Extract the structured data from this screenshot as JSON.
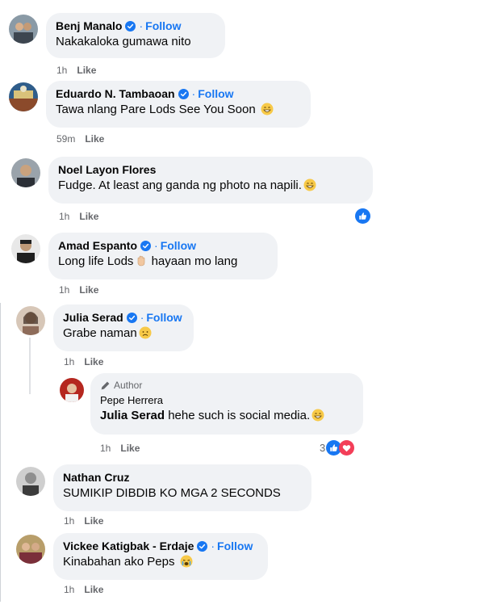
{
  "comments": [
    {
      "name": "Benj Manalo",
      "verified": true,
      "follow": "Follow",
      "text": "Nakakaloka gumawa nito",
      "time": "1h",
      "like": "Like"
    },
    {
      "name": "Eduardo N. Tambaoan",
      "verified": true,
      "follow": "Follow",
      "text": "Tawa nlang Pare Lods See You Soon",
      "time": "59m",
      "like": "Like"
    },
    {
      "name": "Noel Layon Flores",
      "verified": false,
      "text": "Fudge. At least ang ganda ng photo na napili.",
      "time": "1h",
      "like": "Like"
    },
    {
      "name": "Amad Espanto",
      "verified": true,
      "follow": "Follow",
      "text_before": "Long life Lods",
      "text_after": " hayaan mo lang",
      "time": "1h",
      "like": "Like"
    },
    {
      "name": "Julia Serad",
      "verified": true,
      "follow": "Follow",
      "text": "Grabe naman",
      "time": "1h",
      "like": "Like"
    },
    {
      "author_tag": "Author",
      "name": "Pepe Herrera",
      "mention": "Julia Serad",
      "text": " hehe such is social media.",
      "time": "1h",
      "like": "Like",
      "reaction_count": "3"
    },
    {
      "name": "Nathan Cruz",
      "verified": false,
      "text": "SUMIKIP DIBDIB KO MGA 2 SECONDS",
      "time": "1h",
      "like": "Like"
    },
    {
      "name": "Vickee Katigbak - Erdaje",
      "verified": true,
      "follow": "Follow",
      "text": "Kinabahan ako Peps",
      "time": "1h",
      "like": "Like"
    }
  ],
  "separator": "·",
  "colors": {
    "bubble": "#f0f2f5",
    "link": "#1877f2",
    "meta": "#65676b",
    "text": "#050505",
    "love": "#f33e58"
  },
  "icons": [
    "verified-badge-icon",
    "grin-emoji-icon",
    "sad-emoji-icon",
    "hand-emoji-icon",
    "crying-emoji-icon",
    "like-reaction-icon",
    "love-reaction-icon",
    "pencil-icon"
  ]
}
